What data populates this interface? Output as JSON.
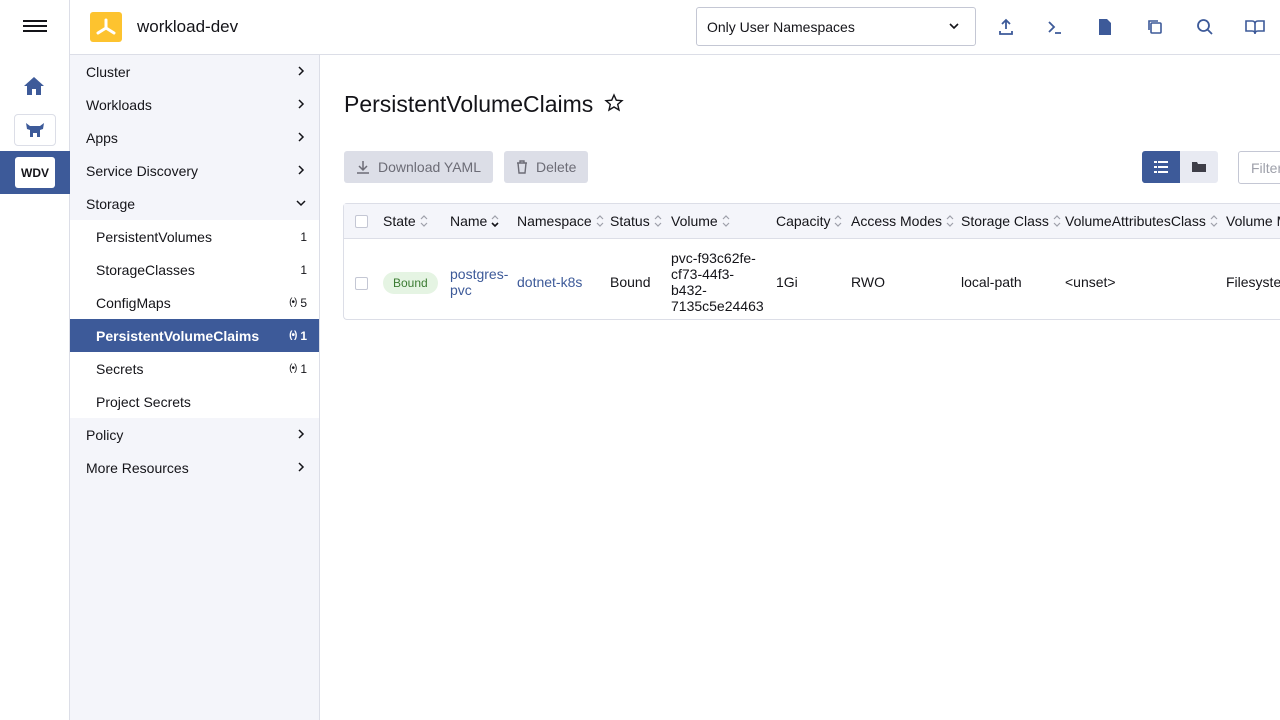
{
  "header": {
    "cluster_name": "workload-dev",
    "namespace_filter": "Only User Namespaces"
  },
  "rail": {
    "cluster_badge": "WDV"
  },
  "sidenav": {
    "groups": [
      {
        "label": "Cluster"
      },
      {
        "label": "Workloads"
      },
      {
        "label": "Apps"
      },
      {
        "label": "Service Discovery"
      },
      {
        "label": "Storage"
      }
    ],
    "storage_items": [
      {
        "label": "PersistentVolumes",
        "count": "1"
      },
      {
        "label": "StorageClasses",
        "count": "1"
      },
      {
        "label": "ConfigMaps",
        "count": "5"
      },
      {
        "label": "PersistentVolumeClaims",
        "count": "1"
      },
      {
        "label": "Secrets",
        "count": "1"
      },
      {
        "label": "Project Secrets",
        "count": ""
      }
    ],
    "after_groups": [
      {
        "label": "Policy"
      },
      {
        "label": "More Resources"
      }
    ]
  },
  "main": {
    "title": "PersistentVolumeClaims",
    "download_label": "Download YAML",
    "delete_label": "Delete",
    "filter_placeholder": "Filter"
  },
  "table": {
    "columns": [
      "State",
      "Name",
      "Namespace",
      "Status",
      "Volume",
      "Capacity",
      "Access Modes",
      "Storage Class",
      "VolumeAttributesClass",
      "Volume M"
    ],
    "rows": [
      {
        "state": "Bound",
        "name_line1": "postgres-",
        "name_line2": "pvc",
        "namespace": "dotnet-k8s",
        "status": "Bound",
        "volume_l1": "pvc-f93c62fe-",
        "volume_l2": "cf73-44f3-",
        "volume_l3": "b432-",
        "volume_l4": "7135c5e24463",
        "capacity": "1Gi",
        "access_modes": "RWO",
        "storage_class": "local-path",
        "vac": "<unset>",
        "volume_mode": "Filesyste"
      }
    ]
  },
  "colors": {
    "accent": "#3d5a99",
    "logo": "#fdc32f",
    "bound_bg": "#e5f4e3",
    "bound_fg": "#3b7b32"
  }
}
